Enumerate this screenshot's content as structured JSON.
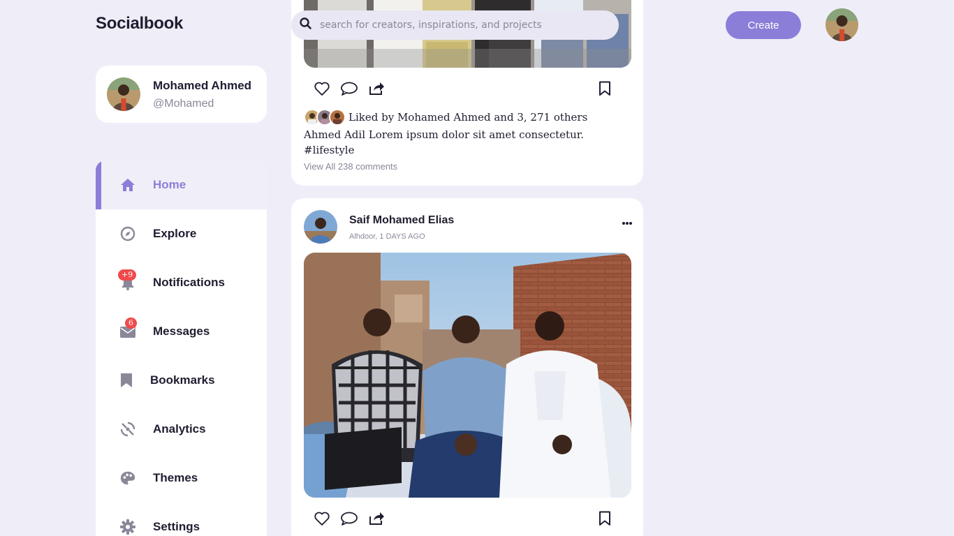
{
  "header": {
    "brand": "Socialbook",
    "search_placeholder": "search for creators, inspirations, and projects",
    "create_label": "Create"
  },
  "profile": {
    "name": "Mohamed Ahmed",
    "handle": "@Mohamed"
  },
  "sidebar": {
    "items": [
      {
        "label": "Home",
        "icon": "home-icon",
        "active": true
      },
      {
        "label": "Explore",
        "icon": "compass-icon"
      },
      {
        "label": "Notifications",
        "icon": "bell-icon",
        "badge": "+9"
      },
      {
        "label": "Messages",
        "icon": "envelope-icon",
        "badge": "6"
      },
      {
        "label": "Bookmarks",
        "icon": "bookmark-icon"
      },
      {
        "label": "Analytics",
        "icon": "chart-icon"
      },
      {
        "label": "Themes",
        "icon": "palette-icon"
      },
      {
        "label": "Settings",
        "icon": "gear-icon"
      }
    ]
  },
  "feed": {
    "post1": {
      "liked_text": "Liked by Mohamed Ahmed and 3, 271 others",
      "caption": "Ahmed Adil Lorem ipsum dolor sit amet consectetur.",
      "hashtag": "#lifestyle",
      "comments_label": "View All 238 comments"
    },
    "post2": {
      "author": "Saif Mohamed Elias",
      "meta": "Alhdoor, 1 DAYS AGO"
    }
  },
  "colors": {
    "accent": "#8b7ed8",
    "background": "#efeef8",
    "badge": "#ef4b4b",
    "text": "#1f1d30",
    "muted": "#8a8799"
  }
}
